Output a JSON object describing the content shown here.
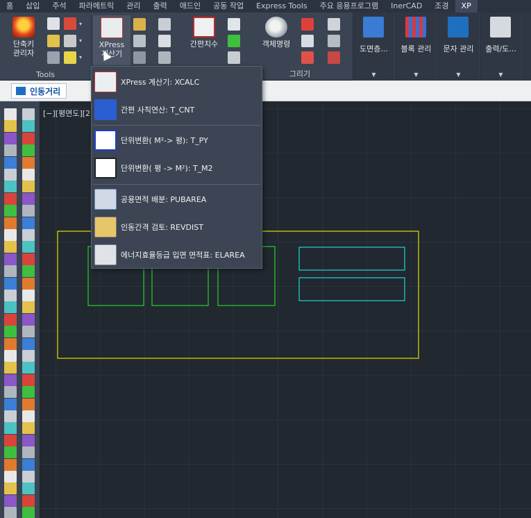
{
  "tabs": [
    {
      "label": "홈"
    },
    {
      "label": "삽입"
    },
    {
      "label": "주석"
    },
    {
      "label": "파라메트릭"
    },
    {
      "label": "관리"
    },
    {
      "label": "출력"
    },
    {
      "label": "애드인"
    },
    {
      "label": "공동 작업"
    },
    {
      "label": "Express Tools"
    },
    {
      "label": "주요 응용프로그램"
    },
    {
      "label": "InerCAD"
    },
    {
      "label": "조경"
    },
    {
      "label": "XP"
    }
  ],
  "ribbon": {
    "tools_panel_label": "Tools",
    "draw_panel_label": "그리기",
    "shortcut_manager_label": "단축키\n관리자",
    "xpress_label": "XPress\n계산기",
    "quick_dim_label": "간편치수",
    "object_cmd_label": "객체명령",
    "dark_panels": [
      {
        "label": "도면층..."
      },
      {
        "label": "블록 관리"
      },
      {
        "label": "문자 관리"
      },
      {
        "label": "출력/도..."
      },
      {
        "label": ""
      }
    ]
  },
  "file_tab": {
    "label": "인동거리"
  },
  "viewport_label": "[−][평면도][2",
  "menu": {
    "items": [
      {
        "label": "XPress 계산기: XCALC",
        "icon": "calculator-icon"
      },
      {
        "label": "간편 사칙연산: T_CNT",
        "icon": "arithmetic-icon"
      },
      {
        "label": "단위변환( M²-> 평): T_PY",
        "icon": "unit-m2-to-py-icon"
      },
      {
        "label": "단위변환( 평 -> M²): T_M2",
        "icon": "unit-py-to-m2-icon"
      },
      {
        "label": "공용면적 배분: PUBAREA",
        "icon": "public-area-icon"
      },
      {
        "label": "인동간격 검토: REVDIST",
        "icon": "review-distance-icon"
      },
      {
        "label": "에너지효율등급 입면 면적표: ELAREA",
        "icon": "energy-area-table-icon"
      }
    ]
  },
  "colors": {
    "yellow": "#e5e000",
    "green": "#23d12a",
    "cyan": "#1ed6d6",
    "accent_blue": "#0e4ea1"
  }
}
